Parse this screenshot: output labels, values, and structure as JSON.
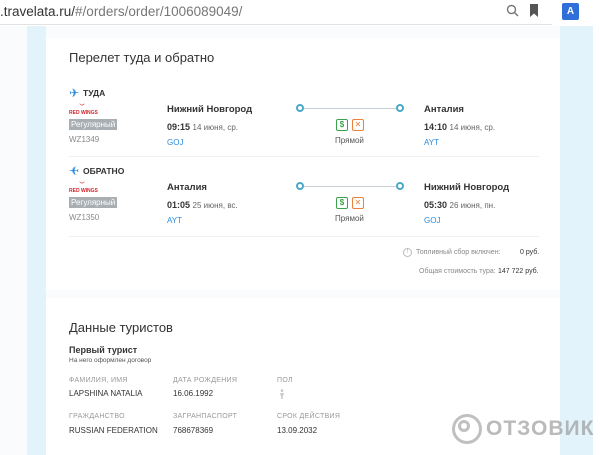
{
  "browser": {
    "url_host": ".travelata.ru/",
    "url_path": "#/orders/order/1006089049/",
    "search_icon": "search-icon",
    "bookmark_icon": "bookmark-icon",
    "translate_icon": "translate-icon",
    "translate_glyph": "A"
  },
  "flight_section": {
    "title": "Перелет туда и обратно",
    "segments": [
      {
        "direction": "ТУДА",
        "airline_logo": "RED WINGS",
        "fare_tag": "Регулярный",
        "flight_no": "WZ1349",
        "dep_city": "Нижний Новгород",
        "dep_time": "09:15",
        "dep_date": "14 июня, ср.",
        "dep_code": "GOJ",
        "arr_city": "Анталия",
        "arr_time": "14:10",
        "arr_date": "14 июня, ср.",
        "arr_code": "AYT",
        "route_type": "Прямой"
      },
      {
        "direction": "ОБРАТНО",
        "airline_logo": "RED WINGS",
        "fare_tag": "Регулярный",
        "flight_no": "WZ1350",
        "dep_city": "Анталия",
        "dep_time": "01:05",
        "dep_date": "25 июня, вс.",
        "dep_code": "AYT",
        "arr_city": "Нижний Новгород",
        "arr_time": "05:30",
        "arr_date": "26 июня, пн.",
        "arr_code": "GOJ",
        "route_type": "Прямой"
      }
    ],
    "fuel_label": "Топливный сбор включен:",
    "fuel_value": "0 руб.",
    "total_label": "Общая стоимость тура:",
    "total_value": "147 722 руб."
  },
  "tourists_section": {
    "title": "Данные туристов",
    "tourist_title": "Первый турист",
    "tourist_note": "На него оформлен договор",
    "fields": {
      "surname_label": "ФАМИЛИЯ, ИМЯ",
      "surname_value": "LAPSHINA NATALIA",
      "birth_label": "ДАТА РОЖДЕНИЯ",
      "birth_value": "16.06.1992",
      "gender_label": "ПОЛ",
      "citizenship_label": "ГРАЖДАНСТВО",
      "citizenship_value": "RUSSIAN FEDERATION",
      "passport_label": "ЗАГРАНПАСПОРТ",
      "passport_value": "768678369",
      "expiry_label": "СРОК ДЕЙСТВИЯ",
      "expiry_value": "13.09.2032"
    }
  },
  "watermark": {
    "text": "ОТЗОВИК"
  },
  "colors": {
    "accent": "#2a8be0",
    "route_dot": "#4aa8c9",
    "side_panel": "#e3f3fb",
    "tag_bg": "#a9aeb3",
    "baggage_green": "#3aa24a",
    "exchange_orange": "#e9813a",
    "airline_red": "#d2232a"
  }
}
